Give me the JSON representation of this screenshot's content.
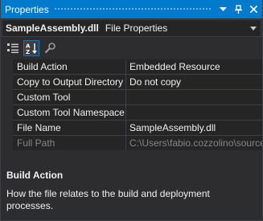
{
  "window": {
    "title": "Properties",
    "accent_color": "#007acc",
    "buttons": [
      {
        "name": "dropdown-arrow-icon",
        "icon": "triangle-down"
      },
      {
        "name": "pin-icon",
        "icon": "pin"
      },
      {
        "name": "close-icon",
        "icon": "x"
      }
    ]
  },
  "object_selector": {
    "name": "SampleAssembly.dll",
    "type": "File Properties"
  },
  "toolbar": {
    "buttons": [
      {
        "name": "categorized-icon",
        "active": false
      },
      {
        "name": "alphabetical-icon",
        "active": true
      },
      {
        "name": "property-pages-icon",
        "active": false
      }
    ]
  },
  "properties": [
    {
      "name": "Build Action",
      "value": "Embedded Resource",
      "enabled": true
    },
    {
      "name": "Copy to Output Directory",
      "value": "Do not copy",
      "enabled": true
    },
    {
      "name": "Custom Tool",
      "value": "",
      "enabled": true
    },
    {
      "name": "Custom Tool Namespace",
      "value": "",
      "enabled": true
    },
    {
      "name": "File Name",
      "value": "SampleAssembly.dll",
      "enabled": true
    },
    {
      "name": "Full Path",
      "value": "C:\\Users\\fabio.cozzolino\\source",
      "enabled": false
    }
  ],
  "description": {
    "title": "Build Action",
    "text": "How the file relates to the build and deployment processes."
  }
}
